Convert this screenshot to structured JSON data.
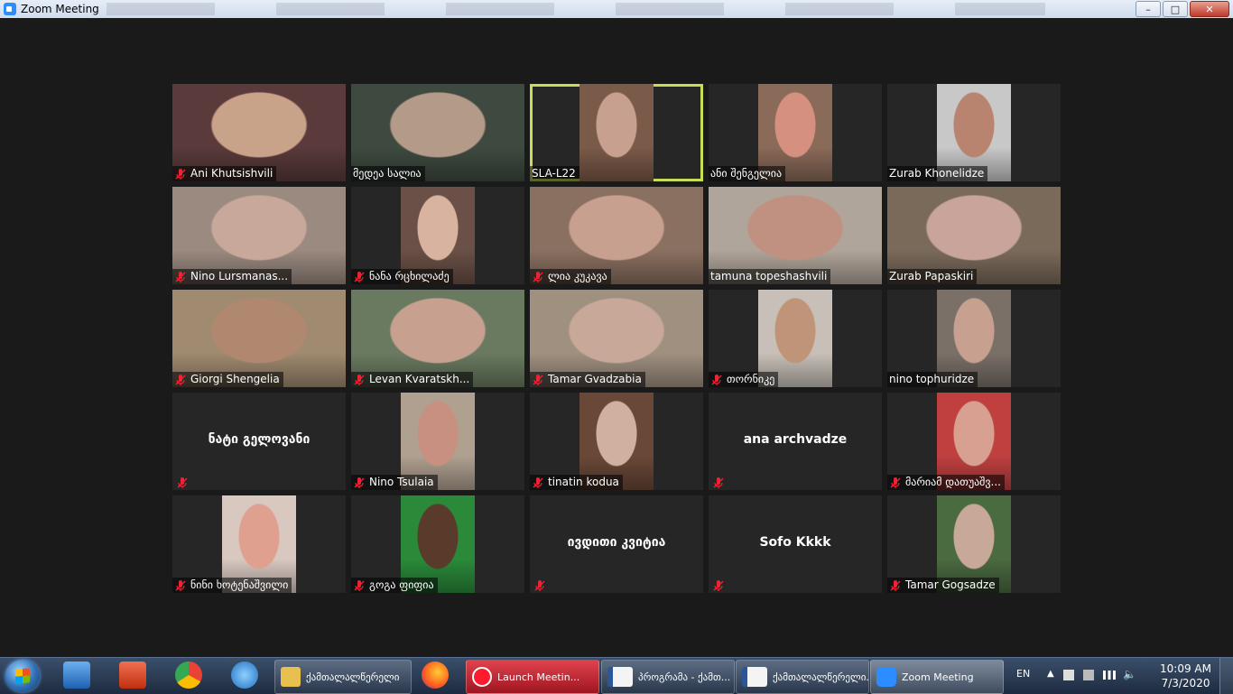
{
  "window": {
    "title": "Zoom Meeting",
    "min": "–",
    "max": "□",
    "close": "✕"
  },
  "participants": [
    {
      "name": "Ani Khutsishvili",
      "muted": true,
      "video": true,
      "bg": "#5a3a3a",
      "face": "#c9a28a"
    },
    {
      "name": "მედეა სალია",
      "muted": false,
      "video": true,
      "bg": "#3e4a40",
      "face": "#b49a88"
    },
    {
      "name": "SLA-L22",
      "muted": false,
      "video": true,
      "active": true,
      "bg": "#7a5a48",
      "face": "#c8a090"
    },
    {
      "name": "ანი შენგელია",
      "muted": false,
      "video": true,
      "bg": "#8a6a58",
      "face": "#d69080"
    },
    {
      "name": "Zurab Khonelidze",
      "muted": false,
      "video": true,
      "bg": "#c8c8c8",
      "face": "#b88470"
    },
    {
      "name": "Nino Lursmanas...",
      "muted": true,
      "video": true,
      "bg": "#9a8a80",
      "face": "#c8a89a"
    },
    {
      "name": "ნანა რცხილაძე",
      "muted": true,
      "video": true,
      "bg": "#6a5046",
      "face": "#d8b4a0"
    },
    {
      "name": "ლია კუკავა",
      "muted": true,
      "video": true,
      "bg": "#8a7060",
      "face": "#c8a090"
    },
    {
      "name": "tamuna topeshashvili",
      "muted": false,
      "video": true,
      "bg": "#b0a59a",
      "face": "#c09080"
    },
    {
      "name": "Zurab Papaskiri",
      "muted": false,
      "video": true,
      "bg": "#7a6a5a",
      "face": "#c8a49a"
    },
    {
      "name": "Giorgi Shengelia",
      "muted": true,
      "video": true,
      "bg": "#a08a70",
      "face": "#b08870"
    },
    {
      "name": "Levan Kvaratskh...",
      "muted": true,
      "video": true,
      "bg": "#6a7a60",
      "face": "#c8a090"
    },
    {
      "name": "Tamar Gvadzabia",
      "muted": true,
      "video": true,
      "bg": "#a09080",
      "face": "#c8a898"
    },
    {
      "name": "თორნიკე",
      "muted": true,
      "video": true,
      "bg": "#c8c0b8",
      "face": "#c09478"
    },
    {
      "name": "nino tophuridze",
      "muted": false,
      "video": true,
      "bg": "#7a7068",
      "face": "#c8a090"
    },
    {
      "name": "ნატი გელოვანი",
      "muted": true,
      "video": false
    },
    {
      "name": "Nino Tsulaia",
      "muted": true,
      "video": true,
      "bg": "#b0a090",
      "face": "#c89080"
    },
    {
      "name": "tinatin kodua",
      "muted": true,
      "video": true,
      "bg": "#6a4838",
      "face": "#d0b0a0"
    },
    {
      "name": "ana archvadze",
      "muted": true,
      "video": false
    },
    {
      "name": "მარიამ დათუაშვ...",
      "muted": true,
      "video": true,
      "bg": "#c04040",
      "face": "#d8a090"
    },
    {
      "name": "ნინი ხოტენაშვილი",
      "muted": true,
      "video": true,
      "bg": "#d8c8c0",
      "face": "#e0a090"
    },
    {
      "name": "გოგა ფიფია",
      "muted": true,
      "video": true,
      "bg": "#2a8a3a",
      "face": "#5a3a2a"
    },
    {
      "name": "ივდითი კვიტია",
      "muted": true,
      "video": false
    },
    {
      "name": "Sofo Kkkk",
      "muted": true,
      "video": false
    },
    {
      "name": "Tamar Gogsadze",
      "muted": true,
      "video": true,
      "bg": "#4a6a40",
      "face": "#c8a898"
    }
  ],
  "taskbar": {
    "items": [
      {
        "label": "ქამთალალწერელი",
        "icon": "folder-icon",
        "color": "#e8c050"
      },
      {
        "label": "Launch Meetin...",
        "icon": "opera-icon",
        "color": "#ff1b2d"
      },
      {
        "label": "პროგრამა - ქამთ...",
        "icon": "word-icon",
        "color": "#2b579a"
      },
      {
        "label": "ქამთალალწერელი...",
        "icon": "word-icon",
        "color": "#2b579a"
      },
      {
        "label": "Zoom Meeting",
        "icon": "zoom-icon",
        "color": "#2d8cff"
      }
    ],
    "lang": "EN",
    "time": "10:09 AM",
    "date": "7/3/2020"
  }
}
